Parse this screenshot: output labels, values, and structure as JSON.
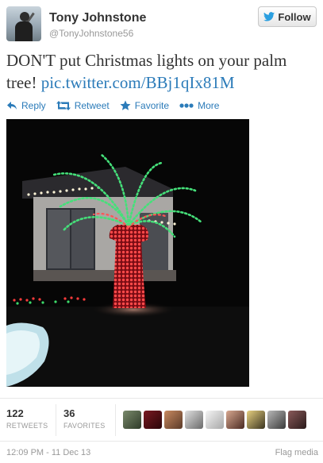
{
  "user": {
    "name": "Tony Johnstone",
    "handle": "@TonyJohnstone56",
    "avatar_icon": "golfer-avatar"
  },
  "follow_button": {
    "label": "Follow",
    "icon": "twitter-bird-icon",
    "accent": "#2b7bb9"
  },
  "tweet": {
    "text": "DON'T put Christmas lights on your palm tree!",
    "link": "pic.twitter.com/BBj1qIx81M"
  },
  "actions": [
    {
      "label": "Reply",
      "icon": "reply-icon"
    },
    {
      "label": "Retweet",
      "icon": "retweet-icon"
    },
    {
      "label": "Favorite",
      "icon": "star-icon"
    },
    {
      "label": "More",
      "icon": "more-dots-icon"
    }
  ],
  "stats": {
    "retweets": {
      "count": "122",
      "label": "RETWEETS"
    },
    "favorites": {
      "count": "36",
      "label": "FAVORITES"
    },
    "favoriter_count": 9
  },
  "footer": {
    "timestamp": "12:09 PM - 11 Dec 13",
    "flag_label": "Flag media"
  },
  "colors": {
    "link": "#2b7bb9",
    "muted": "#999999",
    "text": "#333333"
  }
}
